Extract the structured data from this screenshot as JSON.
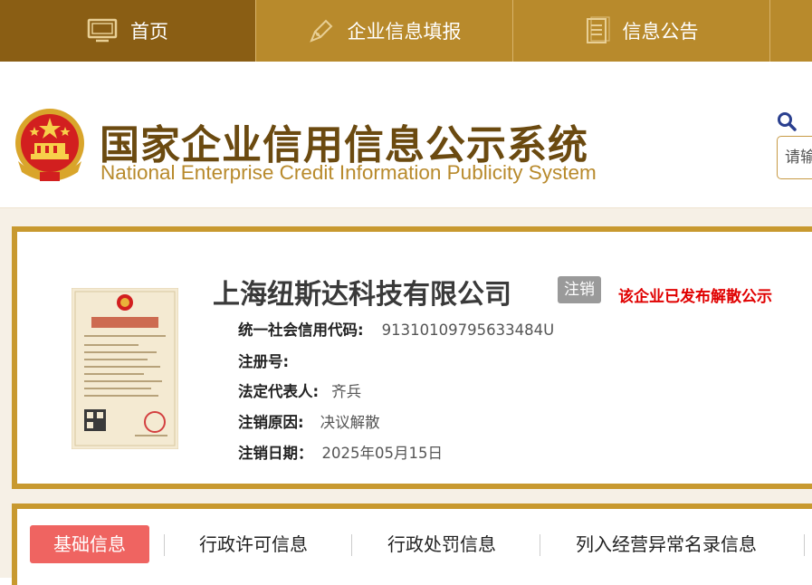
{
  "nav": {
    "items": [
      {
        "label": "首页",
        "icon": "monitor-icon",
        "active": true
      },
      {
        "label": "企业信息填报",
        "icon": "pen-icon",
        "active": false
      },
      {
        "label": "信息公告",
        "icon": "document-icon",
        "active": false
      }
    ]
  },
  "header": {
    "title_cn": "国家企业信用信息公示系统",
    "title_en": "National Enterprise Credit Information Publicity System",
    "emblem_icon": "national-emblem-icon",
    "search_icon": "search-icon",
    "search_placeholder": "请输"
  },
  "company": {
    "name": "上海纽斯达科技有限公司",
    "status": "注销",
    "notice": "该企业已发布解散公示",
    "license_icon": "business-license-image",
    "fields": [
      {
        "label": "统一社会信用代码:",
        "value": "91310109795633484U"
      },
      {
        "label": "注册号:",
        "value": ""
      },
      {
        "label": "法定代表人:",
        "value": "齐兵"
      },
      {
        "label": "注销原因:",
        "value": "决议解散"
      },
      {
        "label": "注销日期：",
        "value": "2025年05月15日"
      }
    ]
  },
  "tabs": [
    {
      "label": "基础信息",
      "active": true
    },
    {
      "label": "行政许可信息",
      "active": false
    },
    {
      "label": "行政处罚信息",
      "active": false
    },
    {
      "label": "列入经营异常名录信息",
      "active": false
    }
  ],
  "colors": {
    "nav_bg": "#b88a2c",
    "nav_active": "#8a5e14",
    "card_border": "#c8992f",
    "status_badge": "#9a9a9a",
    "notice_red": "#e00000",
    "tab_active": "#ef6461"
  }
}
